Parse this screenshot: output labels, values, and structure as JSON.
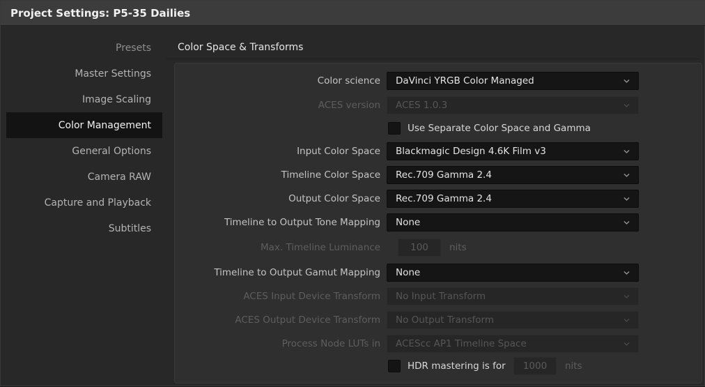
{
  "window": {
    "title": "Project Settings:  P5-35 Dailies"
  },
  "sidebar": {
    "items": [
      {
        "label": "Presets"
      },
      {
        "label": "Master Settings"
      },
      {
        "label": "Image Scaling"
      },
      {
        "label": "Color Management",
        "active": true
      },
      {
        "label": "General Options"
      },
      {
        "label": "Camera RAW"
      },
      {
        "label": "Capture and Playback"
      },
      {
        "label": "Subtitles"
      }
    ]
  },
  "section": {
    "title": "Color Space & Transforms"
  },
  "fields": {
    "color_science": {
      "label": "Color science",
      "value": "DaVinci YRGB Color Managed"
    },
    "aces_version": {
      "label": "ACES version",
      "value": "ACES 1.0.3",
      "enabled": false
    },
    "separate_cs_gamma": {
      "label": "Use Separate Color Space and Gamma",
      "checked": false
    },
    "input_color_space": {
      "label": "Input Color Space",
      "value": "Blackmagic Design 4.6K Film v3"
    },
    "timeline_color_space": {
      "label": "Timeline Color Space",
      "value": "Rec.709 Gamma 2.4"
    },
    "output_color_space": {
      "label": "Output Color Space",
      "value": "Rec.709 Gamma 2.4"
    },
    "tone_mapping": {
      "label": "Timeline to Output Tone Mapping",
      "value": "None"
    },
    "max_luminance": {
      "label": "Max. Timeline Luminance",
      "value": "100",
      "unit": "nits",
      "enabled": false
    },
    "gamut_mapping": {
      "label": "Timeline to Output Gamut Mapping",
      "value": "None"
    },
    "aces_input_transform": {
      "label": "ACES Input Device Transform",
      "value": "No Input Transform",
      "enabled": false
    },
    "aces_output_transform": {
      "label": "ACES Output Device Transform",
      "value": "No Output Transform",
      "enabled": false
    },
    "process_node_luts": {
      "label": "Process Node LUTs in",
      "value": "ACEScc AP1 Timeline Space",
      "enabled": false
    },
    "hdr_mastering": {
      "label": "HDR mastering is for",
      "value": "1000",
      "unit": "nits",
      "checked": false
    }
  },
  "colors": {
    "background": "#282828",
    "titlebar": "#3c3c3c",
    "active_nav": "#131313",
    "dropdown_bg": "#151515"
  }
}
